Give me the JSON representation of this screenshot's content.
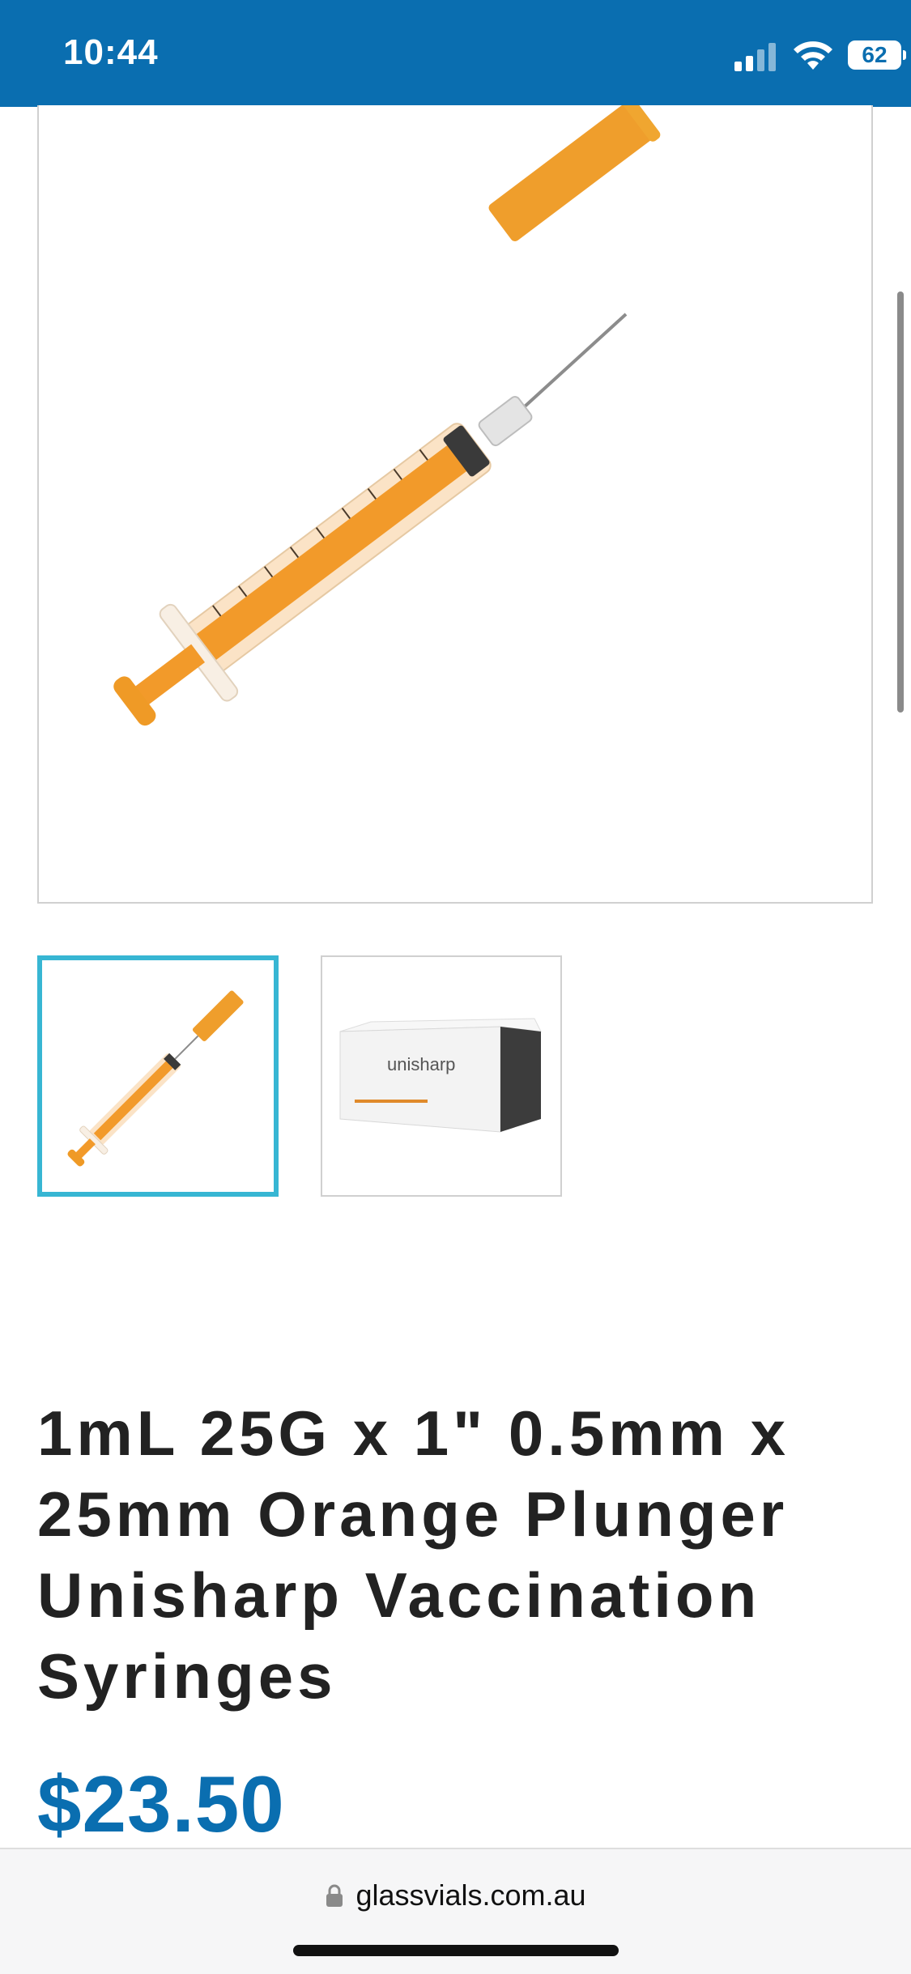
{
  "status_bar": {
    "time": "10:44",
    "battery": "62",
    "background": "#0a6eb0"
  },
  "gallery": {
    "main_image_icon": "syringe-image",
    "thumbnails": [
      {
        "icon": "syringe-thumbnail",
        "selected": true
      },
      {
        "icon": "box-thumbnail",
        "selected": false,
        "box_text": "unisharp"
      }
    ],
    "selected_border_color": "#37b6d3"
  },
  "product": {
    "title": "1mL 25G x 1\" 0.5mm x 25mm Orange Plunger Unisharp Vaccination Syringes",
    "price": "$23.50",
    "price_color": "#0a6eb0"
  },
  "browser": {
    "url": "glassvials.com.au"
  }
}
